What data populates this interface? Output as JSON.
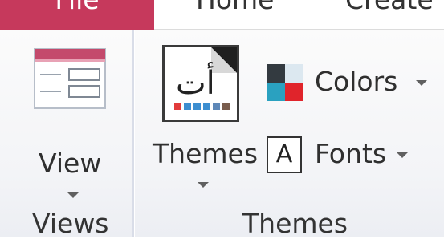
{
  "tabs": [
    {
      "label": "File",
      "active": true,
      "color": "#c6395c"
    },
    {
      "label": "Home",
      "active": false
    },
    {
      "label": "Create",
      "active": false
    }
  ],
  "groups": {
    "views": {
      "label": "Views",
      "view_button": {
        "label": "View",
        "icon": "view-layout-icon"
      }
    },
    "themes": {
      "label": "Themes",
      "themes_button": {
        "label": "Themes",
        "icon": "themes-gallery-icon"
      },
      "colors_button": {
        "label": "Colors",
        "icon": "color-swatch-icon",
        "swatch_colors": [
          "#333a40",
          "#dce8f0",
          "#2aa1c0",
          "#e0242b"
        ]
      },
      "fonts_button": {
        "label": "Fonts",
        "icon": "font-a-icon",
        "icon_text": "A"
      }
    }
  },
  "colors": {
    "ribbon_background": "#f3f4f7",
    "view_icon_accent": "#c44a6c",
    "themes_palette": [
      "#e23b3b",
      "#3d8ed0",
      "#3d8ed0",
      "#3d8ed0",
      "#5e88b8",
      "#7a5d4d"
    ]
  }
}
